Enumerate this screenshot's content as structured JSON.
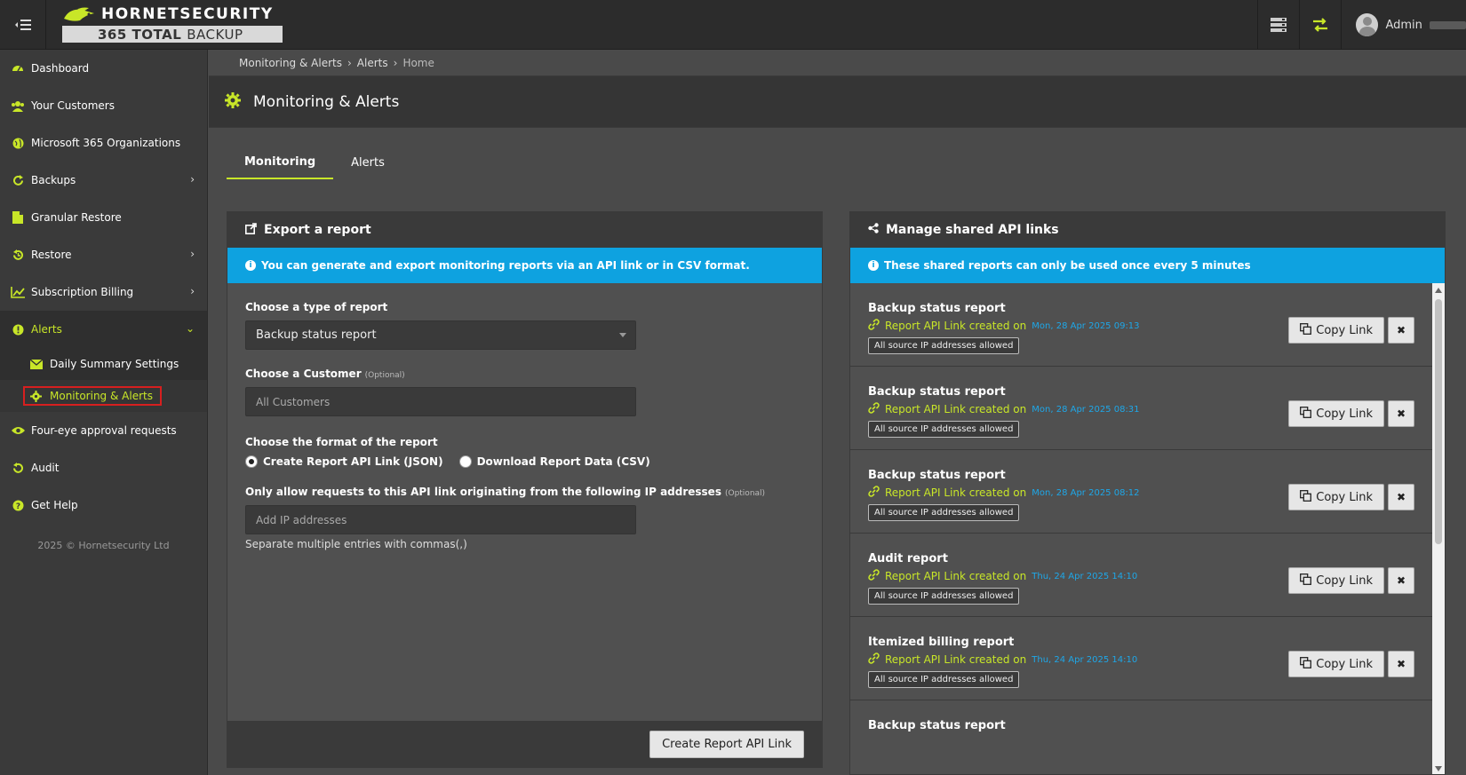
{
  "header": {
    "brand_top": "HORNETSECURITY",
    "brand_bottom_bold": "365 TOTAL",
    "brand_bottom_light": "BACKUP",
    "user_name": "Admin",
    "accent_color": "#c8e628"
  },
  "sidebar": {
    "items": [
      {
        "label": "Dashboard",
        "icon": "dashboard-icon"
      },
      {
        "label": "Your Customers",
        "icon": "users-icon"
      },
      {
        "label": "Microsoft 365 Organizations",
        "icon": "globe-icon"
      },
      {
        "label": "Backups",
        "icon": "refresh-icon"
      },
      {
        "label": "Granular Restore",
        "icon": "file-icon"
      },
      {
        "label": "Restore",
        "icon": "restore-icon"
      },
      {
        "label": "Subscription Billing",
        "icon": "chart-icon"
      },
      {
        "label": "Alerts",
        "icon": "alert-icon"
      },
      {
        "label": "Four-eye approval requests",
        "icon": "eye-icon"
      },
      {
        "label": "Audit",
        "icon": "history-icon"
      },
      {
        "label": "Get Help",
        "icon": "help-icon"
      }
    ],
    "alerts_sub": [
      {
        "label": "Daily Summary Settings",
        "icon": "envelope-icon"
      },
      {
        "label": "Monitoring & Alerts",
        "icon": "gear-icon"
      }
    ],
    "copyright": "2025 © Hornetsecurity Ltd"
  },
  "breadcrumb": [
    "Monitoring & Alerts",
    "Alerts",
    "Home"
  ],
  "page": {
    "title": "Monitoring & Alerts",
    "tabs": [
      "Monitoring",
      "Alerts"
    ]
  },
  "export": {
    "title": "Export a report",
    "info": "You can generate and export monitoring reports via an API link or in CSV format.",
    "type_label": "Choose a type of report",
    "type_value": "Backup status report",
    "customer_label": "Choose a Customer",
    "customer_optional": "(Optional)",
    "customer_placeholder": "All Customers",
    "format_label": "Choose the format of the report",
    "format_json": "Create Report API Link (JSON)",
    "format_csv": "Download Report Data (CSV)",
    "ip_label": "Only allow requests to this API link originating from the following IP addresses",
    "ip_optional": "(Optional)",
    "ip_placeholder": "Add IP addresses",
    "ip_hint": "Separate multiple entries with commas(,)",
    "create_button": "Create Report API Link"
  },
  "shared": {
    "title": "Manage shared API links",
    "info": "These shared reports can only be used once every 5 minutes",
    "created_text": "Report API Link created on",
    "copy_label": "Copy Link",
    "links": [
      {
        "title": "Backup status report",
        "date": "Mon, 28 Apr 2025 09:13",
        "ip": "All source IP addresses allowed"
      },
      {
        "title": "Backup status report",
        "date": "Mon, 28 Apr 2025 08:31",
        "ip": "All source IP addresses allowed"
      },
      {
        "title": "Backup status report",
        "date": "Mon, 28 Apr 2025 08:12",
        "ip": "All source IP addresses allowed"
      },
      {
        "title": "Audit report",
        "date": "Thu, 24 Apr 2025 14:10",
        "ip": "All source IP addresses allowed"
      },
      {
        "title": "Itemized billing report",
        "date": "Thu, 24 Apr 2025 14:10",
        "ip": "All source IP addresses allowed"
      },
      {
        "title": "Backup status report",
        "date": "",
        "ip": ""
      }
    ]
  }
}
